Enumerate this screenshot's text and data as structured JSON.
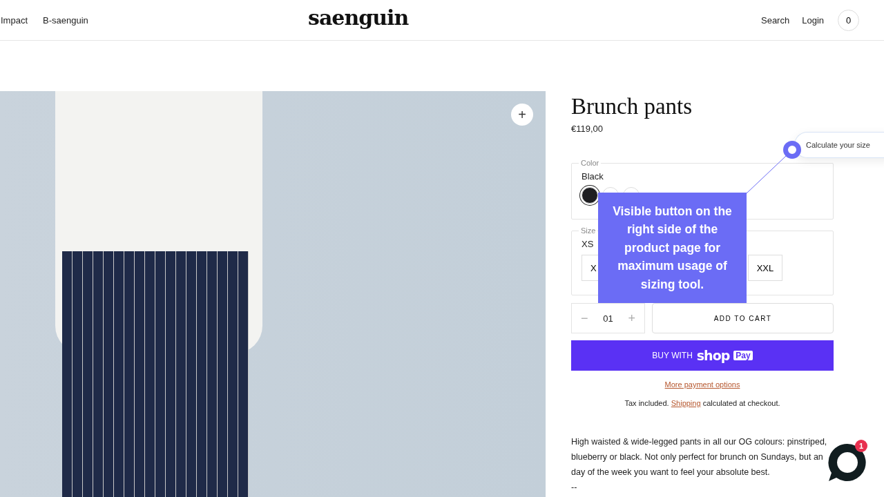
{
  "header": {
    "nav_left": [
      "Impact",
      "B-saenguin"
    ],
    "logo": "saenguin",
    "nav_right": [
      "Search",
      "Login"
    ],
    "cart_count": "0"
  },
  "gallery": {
    "zoom_button": "+"
  },
  "product": {
    "title": "Brunch pants",
    "price": "€119,00",
    "color": {
      "legend": "Color",
      "value": "Black",
      "swatches": [
        {
          "color": "#1e1e22",
          "selected": true
        },
        {
          "color": "#ffffff",
          "selected": false
        },
        {
          "color": "#ffffff",
          "selected": false
        }
      ]
    },
    "size": {
      "legend": "Size",
      "value": "XS",
      "options": [
        {
          "label": "X",
          "selected": false
        },
        {
          "label": "XXL",
          "selected": false
        }
      ]
    },
    "quantity": {
      "minus": "−",
      "value": "01",
      "plus": "+"
    },
    "add_to_cart": "ADD TO CART",
    "buy_button": {
      "prefix": "BUY WITH",
      "brand": "shop",
      "badge": "Pay"
    },
    "more_payment": "More payment options",
    "tax_note": {
      "before": "Tax included.",
      "link": "Shipping",
      "after": "calculated at checkout."
    },
    "description": [
      "High waisted & wide-legged pants in all our OG colours: pinstriped,",
      "blueberry or black. Not only perfect for brunch on Sundays, but an",
      "day of the week you want to feel your absolute best.",
      "--"
    ]
  },
  "size_widget": {
    "label": "Calculate your size"
  },
  "annotation": {
    "text": "Visible button on the right side of the product page for maximum usage of sizing tool."
  },
  "chat": {
    "badge": "1"
  }
}
